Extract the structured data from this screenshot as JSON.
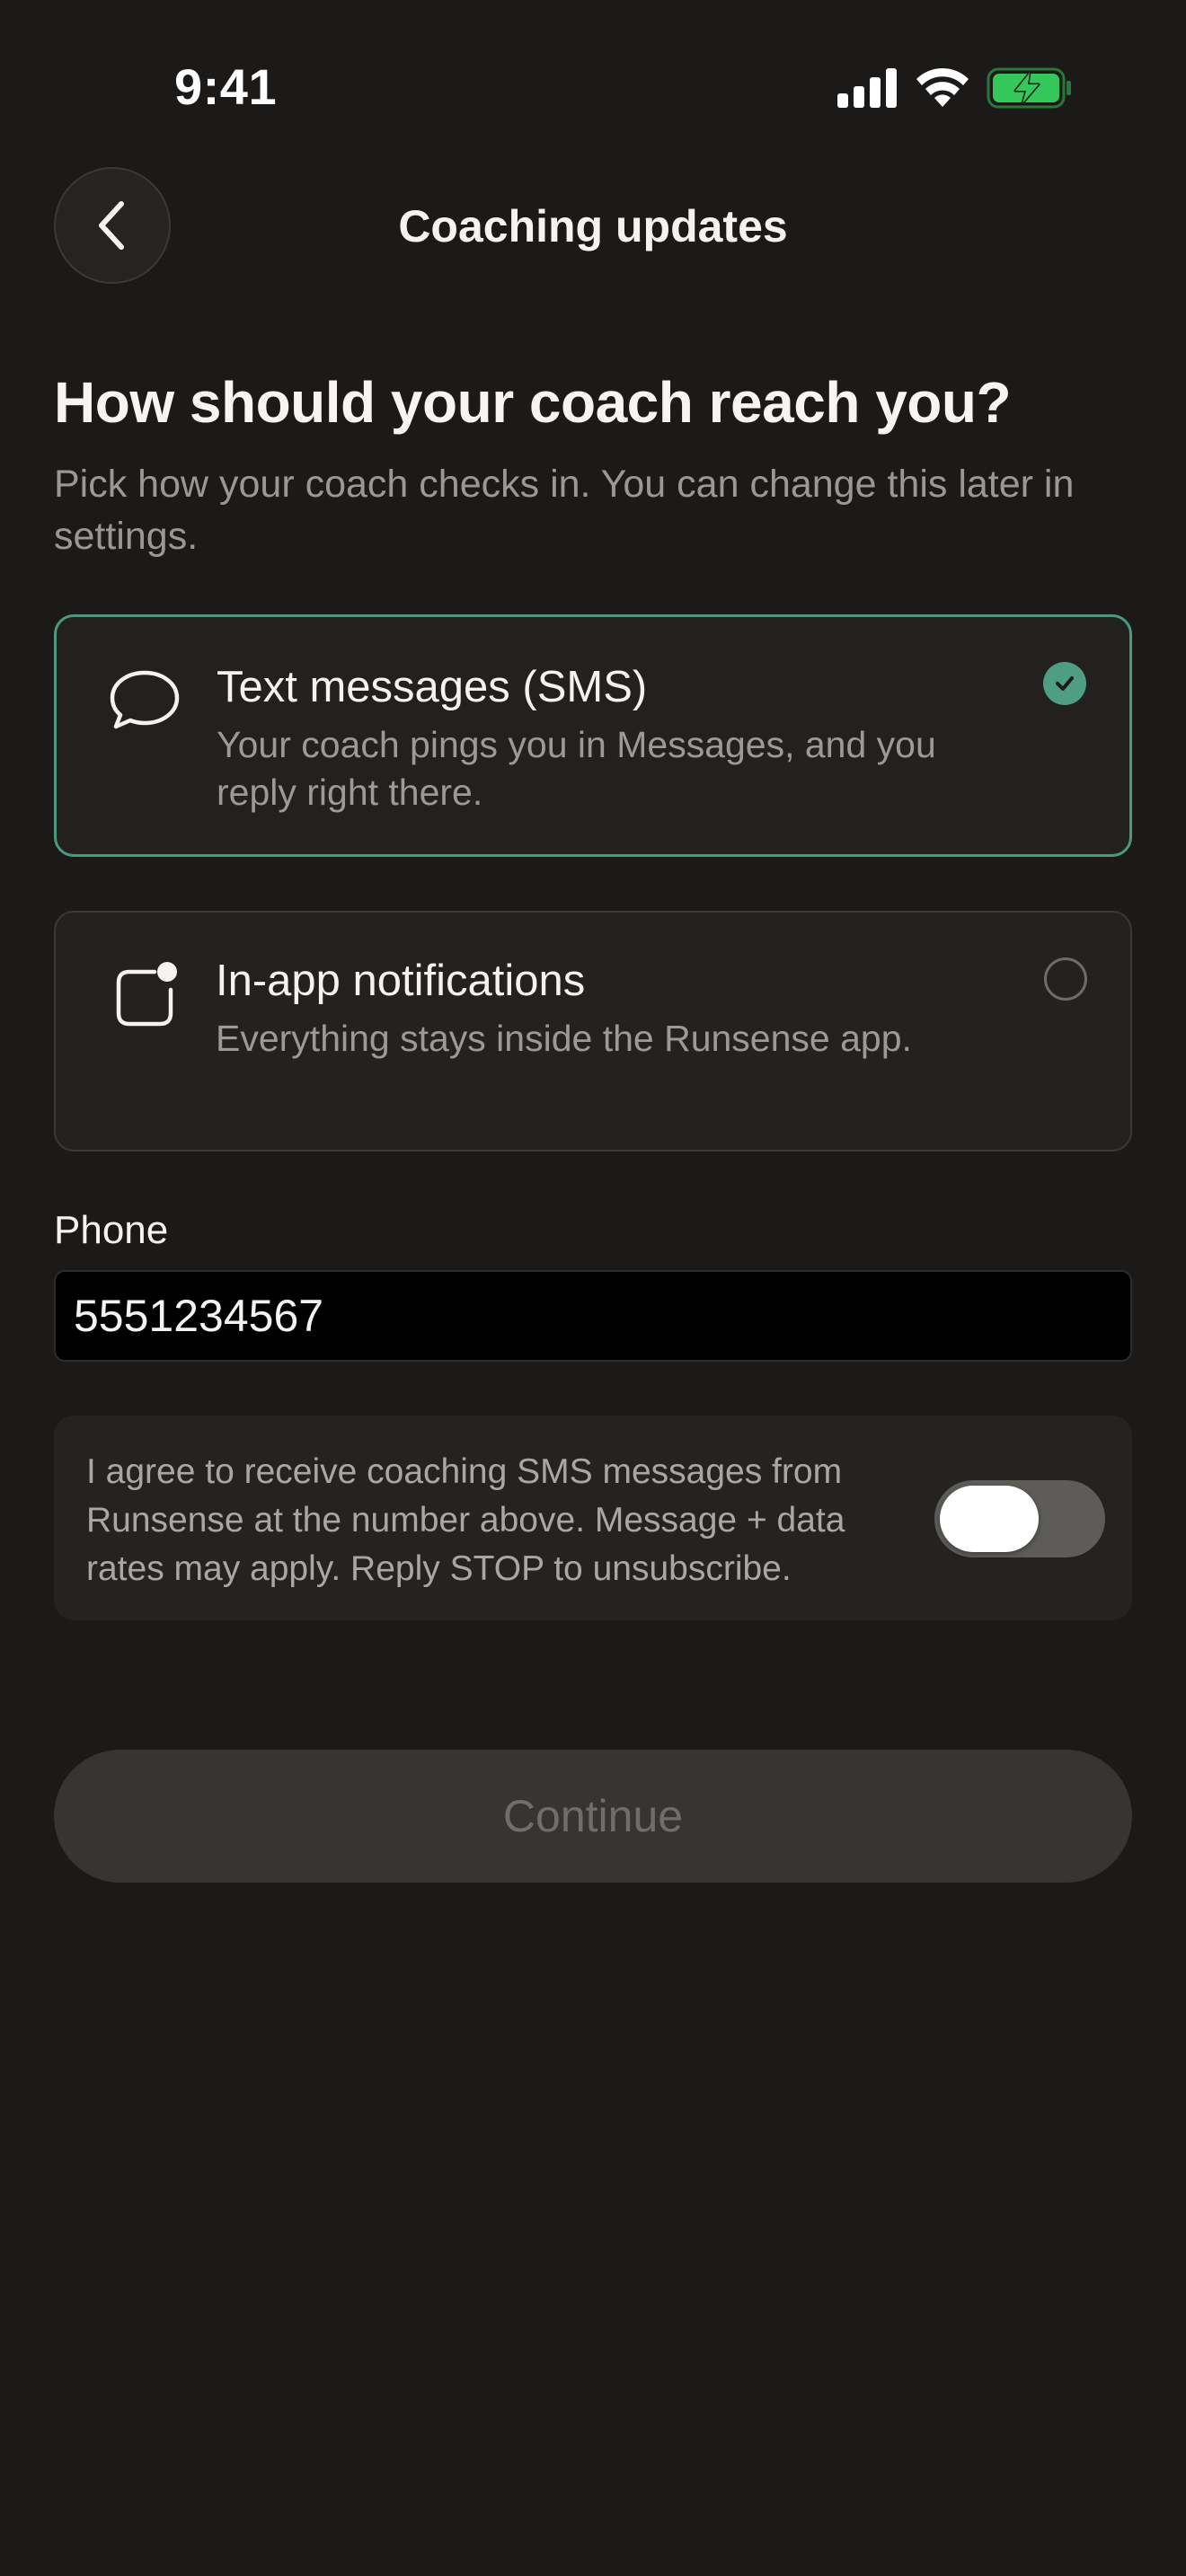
{
  "status_bar": {
    "time": "9:41",
    "icons": [
      "cellular-signal-icon",
      "wifi-icon",
      "battery-charging-icon"
    ],
    "battery_color": "#34c759"
  },
  "header": {
    "title": "Coaching updates",
    "back_icon": "chevron-left-icon"
  },
  "headline": "How should your coach reach you?",
  "subtext": "Pick how your coach checks in. You can change this later in settings.",
  "options": [
    {
      "title": "Text messages (SMS)",
      "description": "Your coach pings you in Messages, and you reply right there.",
      "icon": "speech-bubble-icon",
      "selected": true
    },
    {
      "title": "In-app notifications",
      "description": "Everything stays inside the Runsense app.",
      "icon": "app-notification-icon",
      "selected": false
    }
  ],
  "phone": {
    "label": "Phone",
    "value": "5551234567"
  },
  "consent": {
    "text": "I agree to receive coaching SMS messages from Runsense at the number above. Message + data rates may apply. Reply STOP to unsubscribe.",
    "toggle_on": false
  },
  "continue_label": "Continue",
  "colors": {
    "background": "#1b1a18",
    "accent": "#4e9e84",
    "card": "#232220"
  }
}
